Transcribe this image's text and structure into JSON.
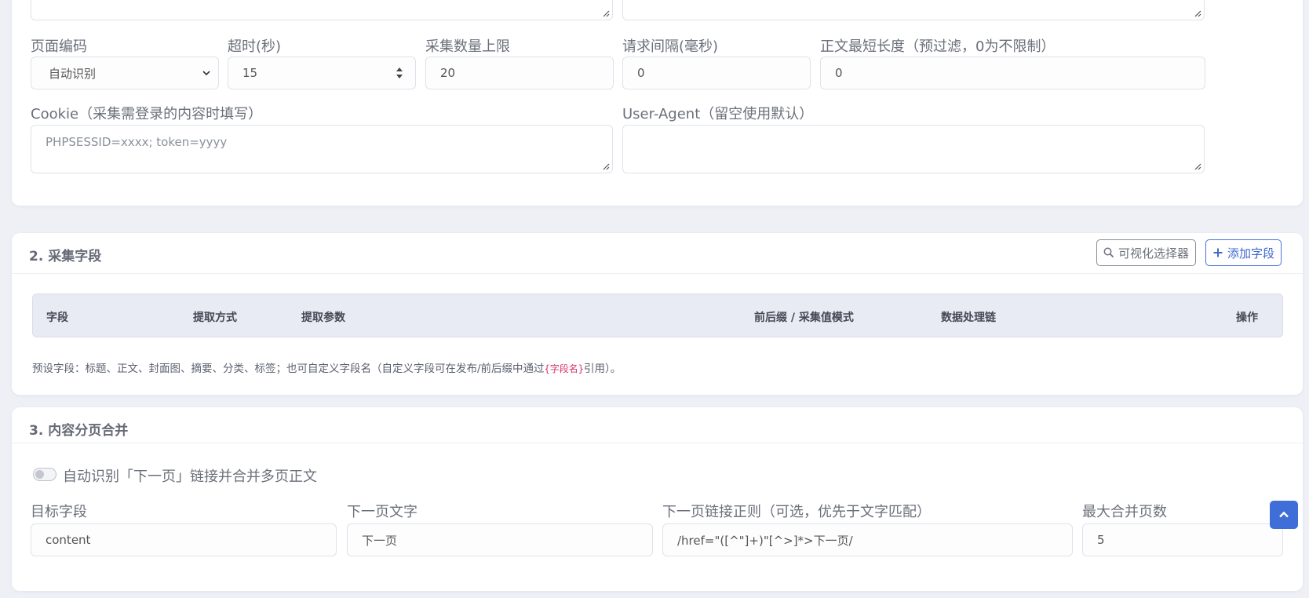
{
  "section1": {
    "encoding": {
      "label": "页面编码",
      "value": "自动识别"
    },
    "timeout": {
      "label": "超时(秒)",
      "value": "15"
    },
    "limit": {
      "label": "采集数量上限",
      "value": "20"
    },
    "interval": {
      "label": "请求间隔(毫秒)",
      "value": "0"
    },
    "minlen": {
      "label": "正文最短长度（预过滤，0为不限制）",
      "value": "0"
    },
    "cookie": {
      "label": "Cookie（采集需登录的内容时填写）",
      "placeholder": "PHPSESSID=xxxx; token=yyyy"
    },
    "useragent": {
      "label": "User-Agent（留空使用默认）",
      "value": ""
    }
  },
  "section2": {
    "title": "2. 采集字段",
    "visual_selector_label": "可视化选择器",
    "add_field_label": "添加字段",
    "columns": [
      "字段",
      "提取方式",
      "提取参数",
      "前后缀 / 采集值模式",
      "数据处理链",
      "操作"
    ],
    "hint_before": "预设字段：标题、正文、封面图、摘要、分类、标签；也可自定义字段名（自定义字段可在发布/前后缀中通过",
    "hint_code": "{字段名}",
    "hint_after": "引用）。"
  },
  "section3": {
    "title": "3. 内容分页合并",
    "toggle_label": "自动识别「下一页」链接并合并多页正文",
    "toggle_on": false,
    "target_field": {
      "label": "目标字段",
      "value": "content"
    },
    "next_text": {
      "label": "下一页文字",
      "value": "下一页"
    },
    "next_regex": {
      "label": "下一页链接正则（可选，优先于文字匹配）",
      "value": "/href=\"([^\"]+)\"[^>]*>下一页/"
    },
    "max_pages": {
      "label": "最大合并页数",
      "value": "5"
    }
  },
  "colors": {
    "accent": "#3f6ed8",
    "code": "#d6336c"
  },
  "icons": {
    "scroll_top": "chevron-up-icon",
    "search": "search-icon",
    "add": "plus-icon"
  }
}
